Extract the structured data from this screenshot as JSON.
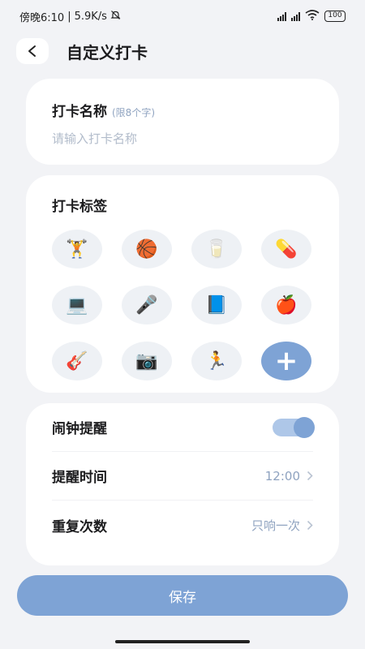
{
  "status_bar": {
    "time": "傍晚6:10",
    "network_speed": "5.9K/s",
    "battery": "100"
  },
  "header": {
    "title": "自定义打卡"
  },
  "name_card": {
    "label": "打卡名称",
    "hint": "(限8个字)",
    "placeholder": "请输入打卡名称"
  },
  "tags_card": {
    "label": "打卡标签",
    "icons": [
      "🏋",
      "🏀",
      "🥛",
      "💊",
      "💻",
      "🎤",
      "📘",
      "🍎",
      "🎸",
      "📷",
      "🏃",
      "+"
    ]
  },
  "settings": {
    "alarm_label": "闹钟提醒",
    "alarm_on": true,
    "time_label": "提醒时间",
    "time_value": "12:00",
    "repeat_label": "重复次数",
    "repeat_value": "只响一次"
  },
  "save_label": "保存",
  "colors": {
    "accent": "#7ea3d5",
    "background": "#f2f3f6",
    "hint": "#8fa3c0"
  }
}
